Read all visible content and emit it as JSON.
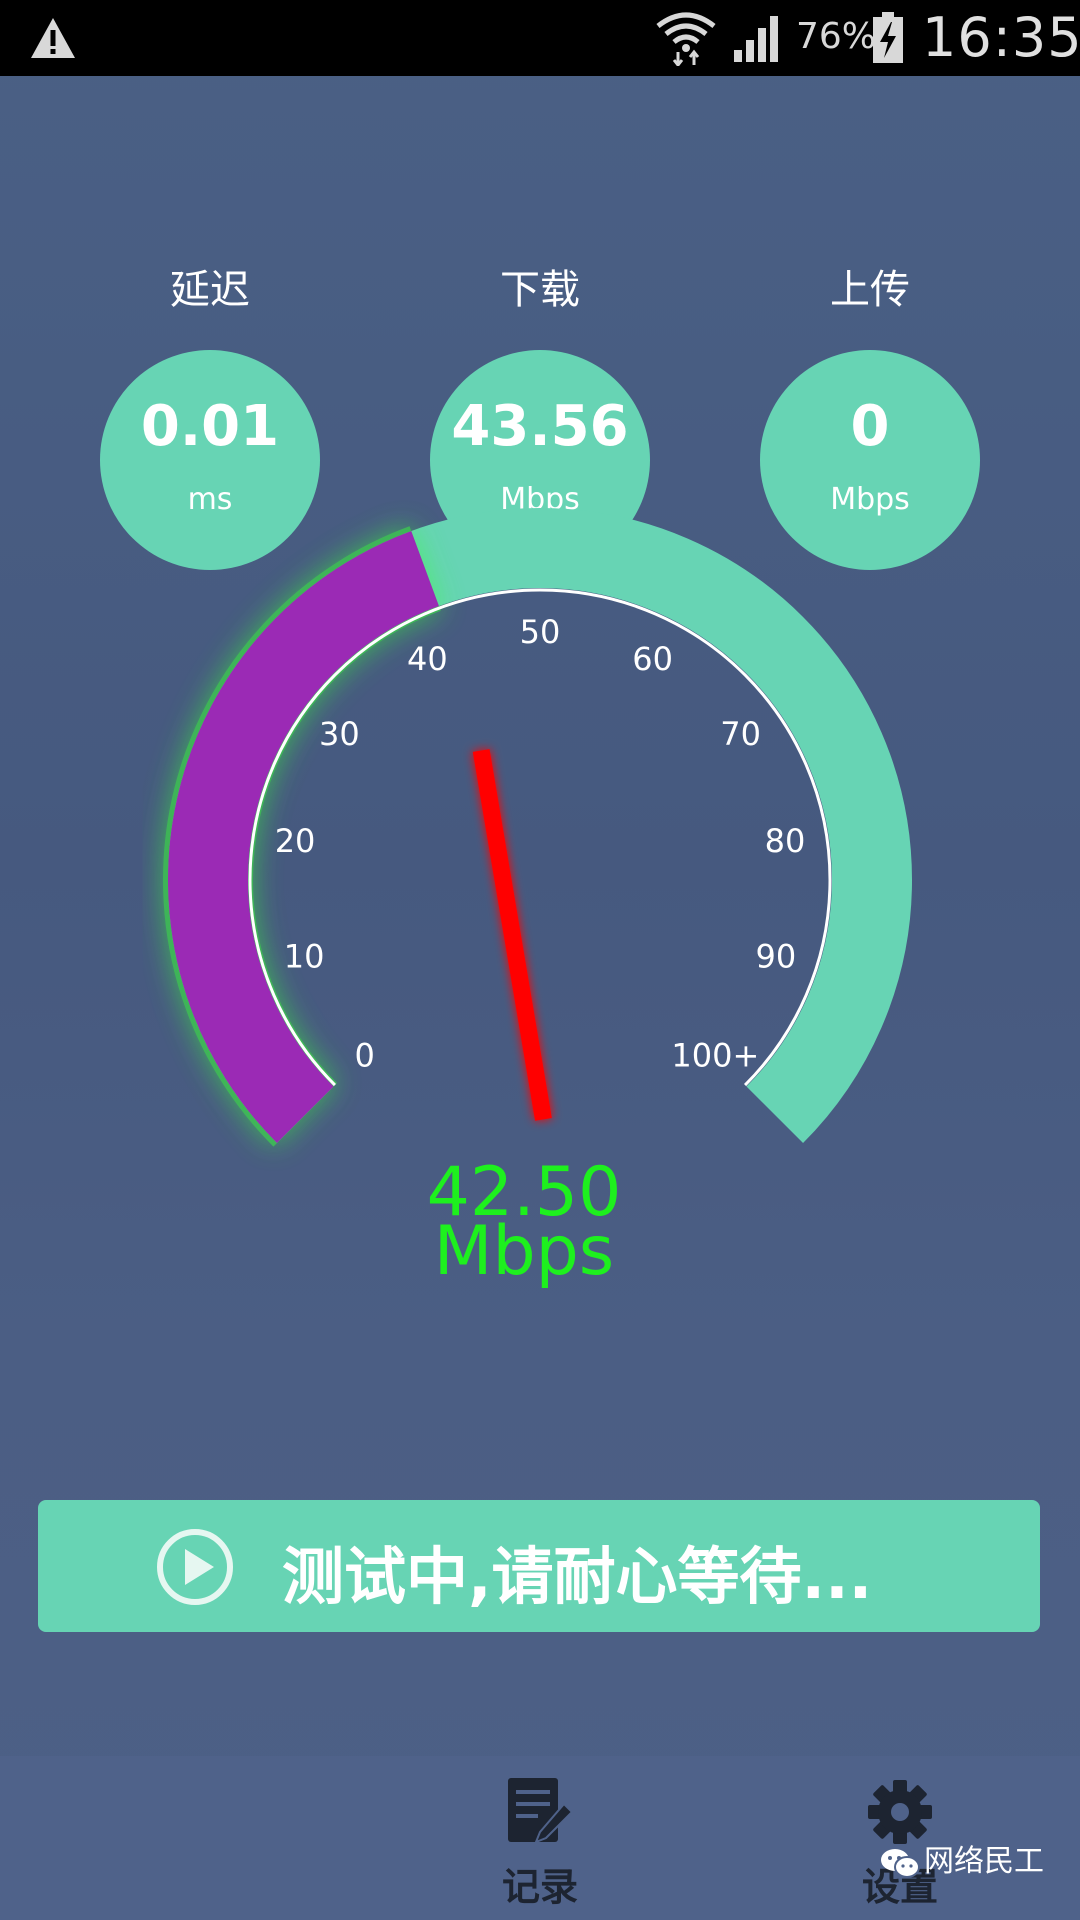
{
  "status_bar": {
    "battery_percent": "76%",
    "time": "16:35",
    "icons": [
      "warning-icon",
      "wifi-icon",
      "signal-icon",
      "battery-charging-icon"
    ]
  },
  "metrics": [
    {
      "label": "延迟",
      "value": "0.01",
      "unit": "ms"
    },
    {
      "label": "下载",
      "value": "43.56",
      "unit": "Mbps"
    },
    {
      "label": "上传",
      "value": "0",
      "unit": "Mbps"
    }
  ],
  "gauge": {
    "ticks": [
      "0",
      "10",
      "20",
      "30",
      "40",
      "50",
      "60",
      "70",
      "80",
      "90",
      "100+"
    ],
    "max": 100,
    "current_value": 42.5,
    "readout_value": "42.50",
    "readout_unit": "Mbps",
    "colors": {
      "progress": "#9b2ab5",
      "track": "#67d4b4",
      "glow": "#39ff39",
      "needle": "#ff0000",
      "readout": "#1ef01e"
    }
  },
  "action": {
    "text": "测试中,请耐心等待...",
    "icon": "play-icon"
  },
  "bottom_nav": {
    "items": [
      {
        "label": "记录",
        "icon": "record-icon"
      },
      {
        "label": "设置",
        "icon": "gear-icon"
      }
    ]
  },
  "watermark": {
    "text": "网络民工",
    "icon": "wechat-icon"
  }
}
